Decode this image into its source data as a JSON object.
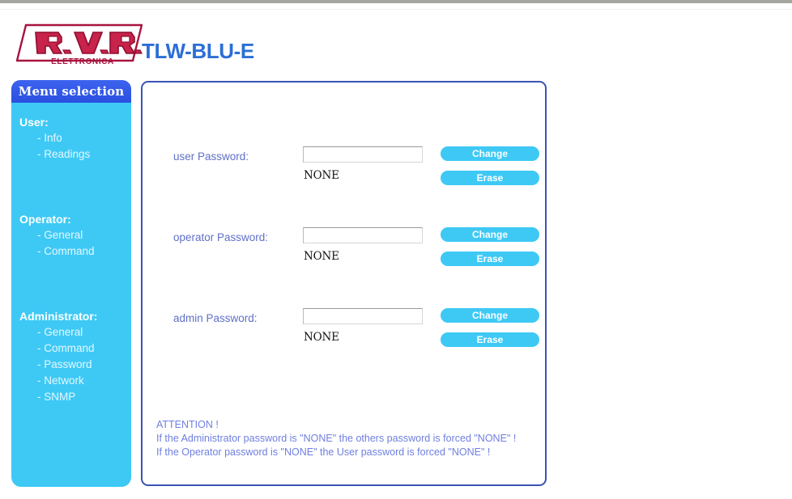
{
  "header": {
    "logo_brand": "R.V.R.",
    "logo_sub": "ELETTRONICA",
    "product_title": "TLW-BLU-E",
    "accent_blue": "#2b6fd6",
    "logo_red": "#a8133f"
  },
  "sidebar": {
    "title": "Menu selection",
    "accent_bg": "#3ec9f5",
    "header_bg": "#2b4fe0",
    "groups": [
      {
        "title": "User:",
        "items": [
          {
            "label": "- Info"
          },
          {
            "label": "- Readings"
          }
        ]
      },
      {
        "title": "Operator:",
        "items": [
          {
            "label": "- General"
          },
          {
            "label": "- Command"
          }
        ]
      },
      {
        "title": "Administrator:",
        "items": [
          {
            "label": "- General"
          },
          {
            "label": "- Command"
          },
          {
            "label": "- Password"
          },
          {
            "label": "- Network"
          },
          {
            "label": "- SNMP"
          }
        ]
      }
    ]
  },
  "main": {
    "rows": [
      {
        "label": "user Password:",
        "value": "",
        "placeholder": "",
        "status": "NONE",
        "change_label": "Change",
        "erase_label": "Erase"
      },
      {
        "label": "operator Password:",
        "value": "",
        "placeholder": "",
        "status": "NONE",
        "change_label": "Change",
        "erase_label": "Erase"
      },
      {
        "label": "admin Password:",
        "value": "",
        "placeholder": "",
        "status": "NONE",
        "change_label": "Change",
        "erase_label": "Erase"
      }
    ],
    "attention": {
      "heading": "ATTENTION !",
      "line1": "If the Administrator password is \"NONE\" the others password is forced \"NONE\" !",
      "line2": "If the Operator password is \"NONE\" the User password is forced \"NONE\" !",
      "color": "#6f7fe0"
    }
  }
}
